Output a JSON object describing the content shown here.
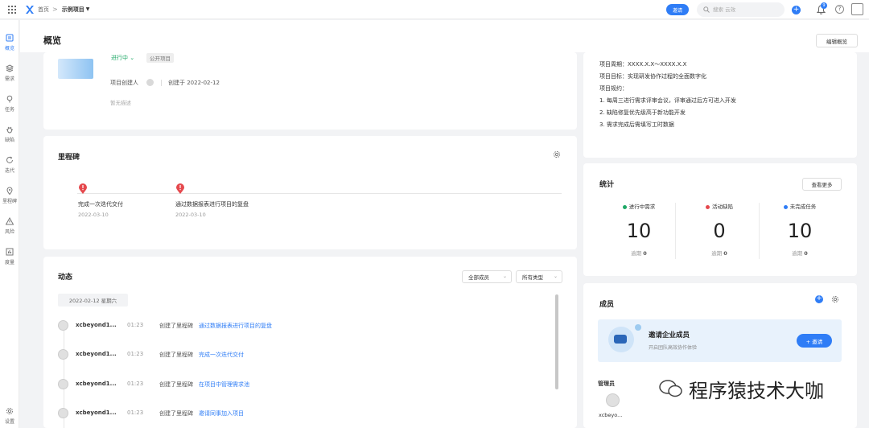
{
  "topbar": {
    "home": "首页",
    "separator": ">",
    "project": "示例项目",
    "invite": "邀请",
    "search_placeholder": "搜索 云效",
    "notification_count": "9"
  },
  "sidebar": {
    "items": [
      {
        "label": "概览"
      },
      {
        "label": "需求"
      },
      {
        "label": "任务"
      },
      {
        "label": "缺陷"
      },
      {
        "label": "迭代"
      },
      {
        "label": "里程碑"
      },
      {
        "label": "风险"
      },
      {
        "label": "度量"
      },
      {
        "label": "设置"
      }
    ]
  },
  "page": {
    "title": "概览",
    "edit_button": "编辑概览"
  },
  "overview": {
    "status": "进行中",
    "visibility": "公开项目",
    "creator_label": "项目创建人",
    "created_at": "创建于 2022-02-12",
    "no_description": "暂无描述"
  },
  "description": {
    "lines": [
      "项目周期：XXXX.X.X～XXXX.X.X",
      "项目目标：实现研发协作过程的全面数字化",
      "项目规约：",
      "1.   每周三进行需求评审会议，评审通过后方可进入开发",
      "2.   缺陷修复优先级高于新功能开发",
      "3.   需求完成后需填写工时数据"
    ]
  },
  "milestones": {
    "title": "里程碑",
    "items": [
      {
        "name": "完成一次迭代交付",
        "date": "2022-03-10"
      },
      {
        "name": "通过数据报表进行项目的复盘",
        "date": "2022-03-10"
      }
    ]
  },
  "activity": {
    "title": "动态",
    "filter_members": "全部成员",
    "filter_types": "所有类型",
    "date": "2022-02-12 星期六",
    "rows": [
      {
        "user": "xcbeyond1...",
        "time": "01:23",
        "verb": "创建了里程碑",
        "target": "通过数据报表进行项目的复盘"
      },
      {
        "user": "xcbeyond1...",
        "time": "01:23",
        "verb": "创建了里程碑",
        "target": "完成一次迭代交付"
      },
      {
        "user": "xcbeyond1...",
        "time": "01:23",
        "verb": "创建了里程碑",
        "target": "在项目中管理需求池"
      },
      {
        "user": "xcbeyond1...",
        "time": "01:23",
        "verb": "创建了里程碑",
        "target": "邀请同事加入项目"
      }
    ]
  },
  "stats": {
    "title": "统计",
    "more": "查看更多",
    "items": [
      {
        "label": "进行中需求",
        "value": "10",
        "overdue_label": "逾期",
        "overdue": "0",
        "color": "#1ea866"
      },
      {
        "label": "活动缺陷",
        "value": "0",
        "overdue_label": "逾期",
        "overdue": "0",
        "color": "#e5484d"
      },
      {
        "label": "未完成任务",
        "value": "10",
        "overdue_label": "逾期",
        "overdue": "0",
        "color": "#2f7df6"
      }
    ]
  },
  "members": {
    "title": "成员",
    "invite_title": "邀请企业成员",
    "invite_subtitle": "开启团队高效协作体验",
    "invite_button": "+ 邀请",
    "admin_label": "管理员",
    "admin_name": "xcbeyo..."
  },
  "watermark": "程序猿技术大咖",
  "colors": {
    "accent": "#2f7df6",
    "success": "#1ea866",
    "danger": "#e5484d",
    "background": "#f2f3f5"
  }
}
